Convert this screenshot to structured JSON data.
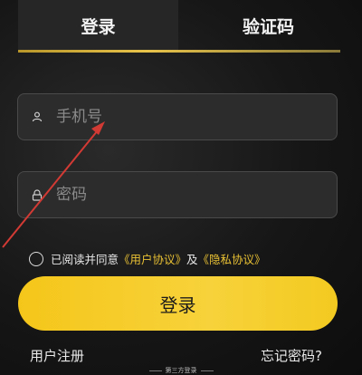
{
  "tabs": [
    {
      "label": "登录"
    },
    {
      "label": "验证码"
    }
  ],
  "phone_input": {
    "placeholder": "手机号",
    "value": ""
  },
  "password_input": {
    "placeholder": "密码",
    "value": ""
  },
  "agreement": {
    "prefix": "已阅读并同意",
    "user_agreement": "《用户协议》",
    "conjunction": "及",
    "privacy_agreement": "《隐私协议》"
  },
  "login_button": {
    "label": "登录"
  },
  "register_link": {
    "label": "用户注册"
  },
  "forgot_link": {
    "label": "忘记密码?"
  },
  "third_party": {
    "label": "第三方登录"
  },
  "colors": {
    "accent": "#f5c61a",
    "link": "#e8c034",
    "annotation_arrow": "#d23a34"
  },
  "icons": [
    "user-icon",
    "lock-icon"
  ]
}
